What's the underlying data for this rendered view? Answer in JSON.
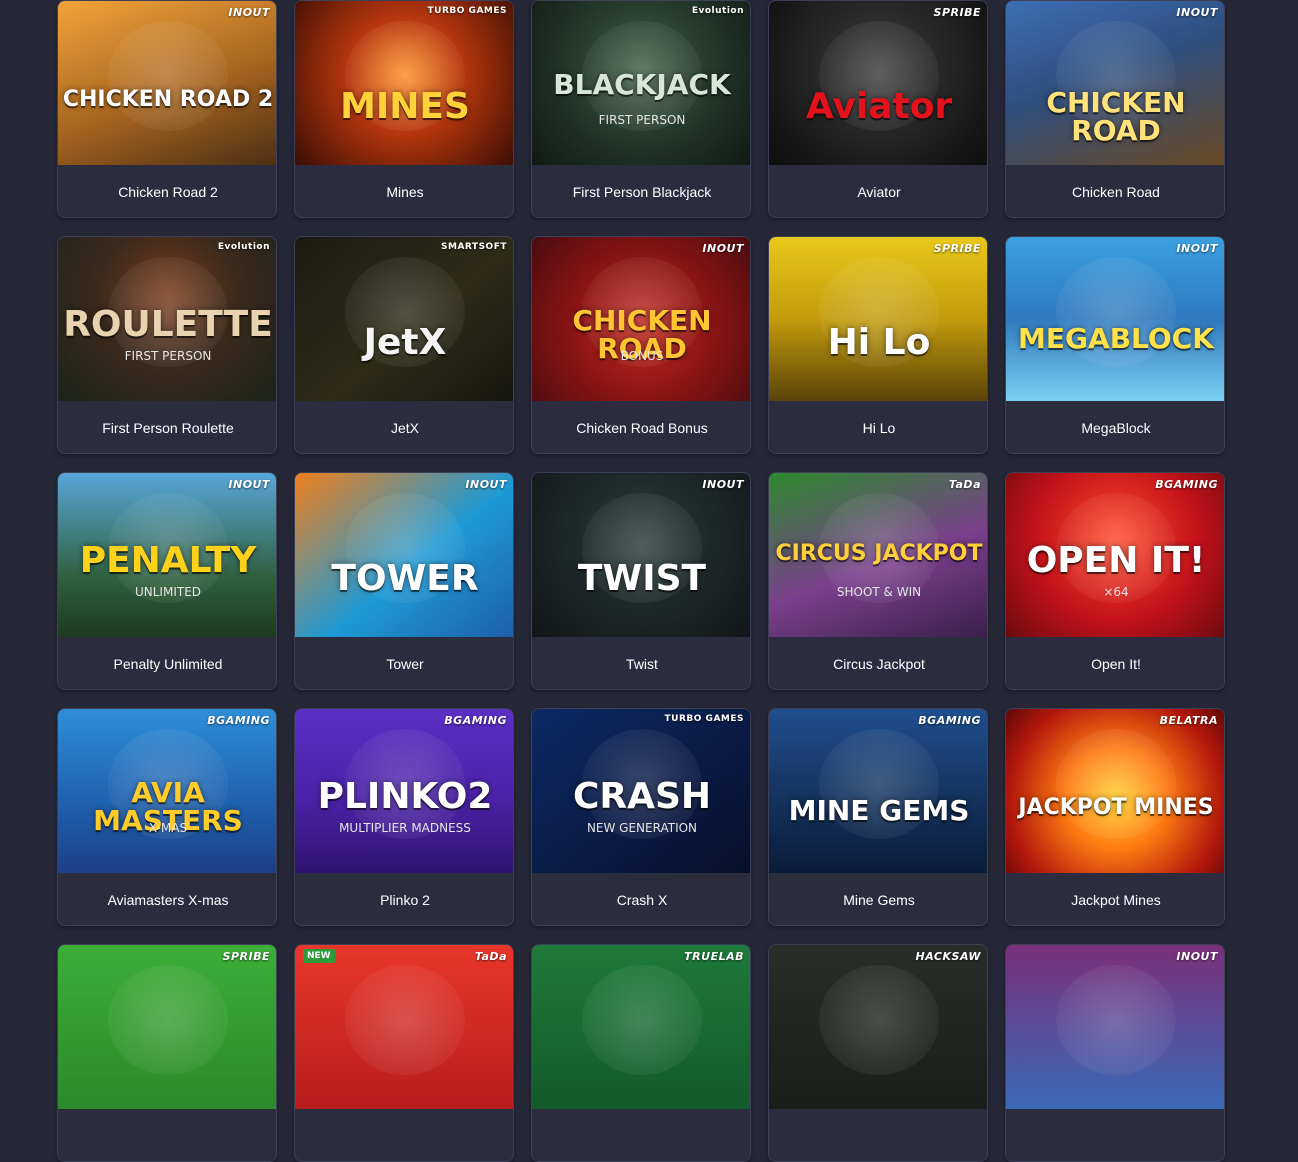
{
  "games": [
    {
      "title": "Chicken Road 2",
      "provider": "INOUT",
      "logo": "CHICKEN ROAD 2",
      "bg": "linear-gradient(160deg,#f3a33a 0%,#a7651f 55%,#4d2f14 100%)",
      "logo_color": "#ffffff"
    },
    {
      "title": "Mines",
      "provider": "TURBO GAMES",
      "logo": "MINES",
      "bg": "radial-gradient(circle at 50% 45%,#ff8a1f 0%,#b7370d 40%,#3a0d05 100%)",
      "logo_color": "#ffd23a"
    },
    {
      "title": "First Person Blackjack",
      "provider": "Evolution",
      "logo": "BLACKJACK",
      "sub": "FIRST PERSON",
      "bg": "radial-gradient(circle at 50% 40%,#3e5e46 0%,#203428 55%,#101912 100%)",
      "logo_color": "#d8e6da"
    },
    {
      "title": "Aviator",
      "provider": "SPRIBE",
      "logo": "Aviator",
      "bg": "radial-gradient(circle at 50% 40%,#3c3c3c 0%,#1a1a1a 70%,#0d0d0d 100%)",
      "logo_color": "#e3121b"
    },
    {
      "title": "Chicken Road",
      "provider": "INOUT",
      "logo": "CHICKEN ROAD",
      "bg": "linear-gradient(160deg,#3d6fb5 0%,#2e4e7e 45%,#6b4a24 100%)",
      "logo_color": "#ffe27a"
    },
    {
      "title": "First Person Roulette",
      "provider": "Evolution",
      "logo": "ROULETTE",
      "sub": "FIRST PERSON",
      "bg": "radial-gradient(circle at 50% 35%,#7a3b1c 0%,#3b2a1c 45%,#1c241b 100%)",
      "logo_color": "#e9d2b0"
    },
    {
      "title": "JetX",
      "provider": "SMARTSOFT",
      "logo": "JetX",
      "bg": "linear-gradient(140deg,#1b1b14 0%,#2e2c16 55%,#161611 100%)",
      "logo_color": "#f4f4f4"
    },
    {
      "title": "Chicken Road Bonus",
      "provider": "INOUT",
      "logo": "CHICKEN ROAD",
      "sub": "BONUS",
      "bg": "radial-gradient(circle at 50% 55%,#c3281c 0%,#8a1414 50%,#4a0c10 100%)",
      "logo_color": "#ffc533"
    },
    {
      "title": "Hi Lo",
      "provider": "SPRIBE",
      "logo": "Hi Lo",
      "bg": "linear-gradient(180deg,#e9c81a 0%,#c39b0c 50%,#5a4309 100%)",
      "logo_color": "#ffffff"
    },
    {
      "title": "MegaBlock",
      "provider": "INOUT",
      "logo": "MEGABLOCK",
      "bg": "linear-gradient(180deg,#3aa0e0 0%,#2f79bf 50%,#7ad0f2 100%)",
      "logo_color": "#ffe14a"
    },
    {
      "title": "Penalty Unlimited",
      "provider": "INOUT",
      "logo": "PENALTY",
      "sub": "UNLIMITED",
      "bg": "linear-gradient(180deg,#58a6d9 0%,#2e5f3b 65%,#1d3a1f 100%)",
      "logo_color": "#ffd21a"
    },
    {
      "title": "Tower",
      "provider": "INOUT",
      "logo": "TOWER",
      "bg": "linear-gradient(140deg,#f07f1b 0%,#1e9ad5 55%,#1d5fa8 100%)",
      "logo_color": "#ffffff"
    },
    {
      "title": "Twist",
      "provider": "INOUT",
      "logo": "TWIST",
      "bg": "radial-gradient(circle at 50% 40%,#2a3b3a 0%,#1b2325 60%,#121618 100%)",
      "logo_color": "#ffffff"
    },
    {
      "title": "Circus Jackpot",
      "provider": "TaDa",
      "logo": "CIRCUS JACKPOT",
      "sub": "SHOOT & WIN",
      "bg": "linear-gradient(160deg,#2e8a2e 0%,#7a3f8c 55%,#3a1f4a 100%)",
      "logo_color": "#ffcf3a"
    },
    {
      "title": "Open It!",
      "provider": "BGAMING",
      "logo": "OPEN IT!",
      "sub": "×64",
      "bg": "radial-gradient(circle at 50% 40%,#ff4a2a 0%,#c4121a 55%,#6a0a0e 100%)",
      "logo_color": "#ffffff"
    },
    {
      "title": "Aviamasters X-mas",
      "provider": "BGAMING",
      "logo": "AVIA MASTERS",
      "sub": "X-MAS",
      "bg": "linear-gradient(180deg,#2f8ed8 0%,#1f63b0 55%,#1d3f88 100%)",
      "logo_color": "#ffcc2a"
    },
    {
      "title": "Plinko 2",
      "provider": "BGAMING",
      "logo": "PLINKO2",
      "sub": "MULTIPLIER MADNESS",
      "bg": "linear-gradient(180deg,#5a2fc4 0%,#4a22a8 55%,#2e1470 100%)",
      "logo_color": "#ffffff"
    },
    {
      "title": "Crash X",
      "provider": "TURBO GAMES",
      "logo": "CRASH",
      "sub": "NEW GENERATION",
      "bg": "linear-gradient(140deg,#0d2a66 0%,#0a1b45 55%,#061029 100%)",
      "logo_color": "#ffffff"
    },
    {
      "title": "Mine Gems",
      "provider": "BGAMING",
      "logo": "MINE GEMS",
      "bg": "linear-gradient(180deg,#1f4f8e 0%,#14325e 55%,#0a1c38 100%)",
      "logo_color": "#ffffff"
    },
    {
      "title": "Jackpot Mines",
      "provider": "BELATRA",
      "logo": "JACKPOT MINES",
      "bg": "radial-gradient(circle at 50% 55%,#ffcf24 0%,#ff7b12 35%,#b2170c 75%,#5e0808 100%)",
      "logo_color": "#ffffff"
    },
    {
      "title": "",
      "provider": "SPRIBE",
      "logo": "",
      "bg": "linear-gradient(180deg,#3cae38 0%,#2a8a2a 100%)",
      "logo_color": "#ffffff"
    },
    {
      "title": "",
      "provider": "TaDa",
      "badge": "NEW",
      "logo": "",
      "bg": "linear-gradient(180deg,#e8362a 0%,#b81d1d 100%)",
      "logo_color": "#ffffff"
    },
    {
      "title": "",
      "provider": "TRUELAB",
      "logo": "",
      "bg": "linear-gradient(180deg,#1e7a3a 0%,#145a2a 100%)",
      "logo_color": "#ffffff"
    },
    {
      "title": "",
      "provider": "HACKSAW",
      "logo": "",
      "bg": "linear-gradient(180deg,#2a2e2a 0%,#1a1d1a 100%)",
      "logo_color": "#ffffff"
    },
    {
      "title": "",
      "provider": "INOUT",
      "logo": "",
      "bg": "linear-gradient(180deg,#7a2f7a 0%,#3a6ab8 100%)",
      "logo_color": "#ffffff"
    }
  ]
}
